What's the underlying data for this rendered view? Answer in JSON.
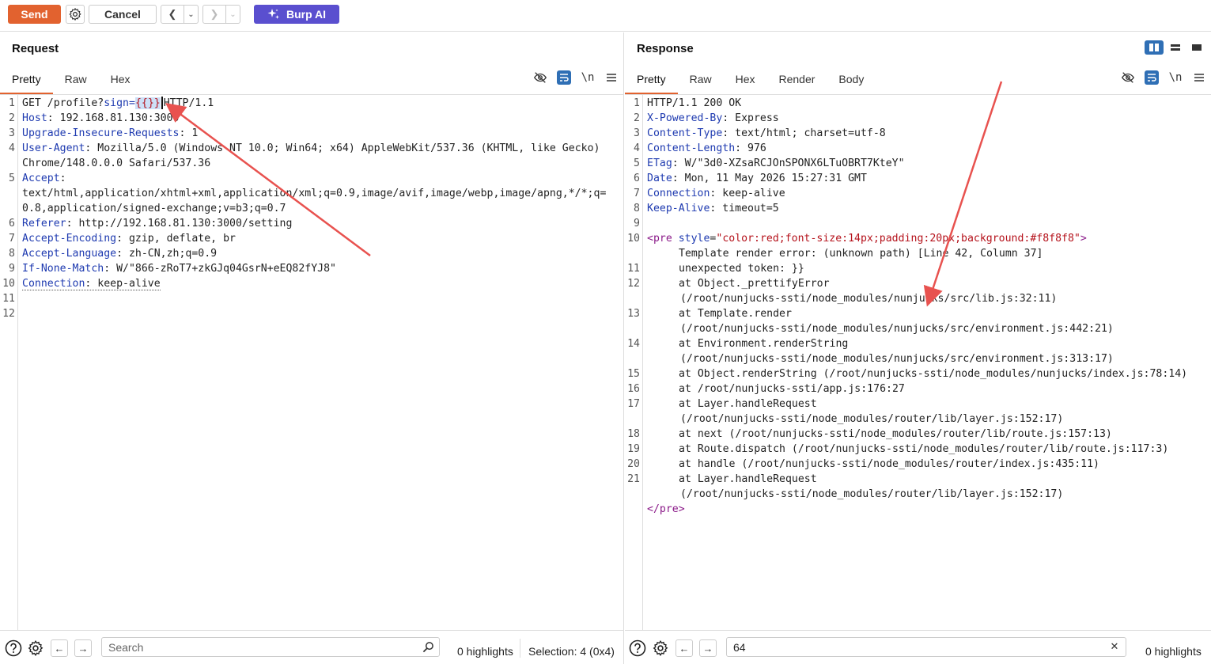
{
  "toolbar": {
    "send_label": "Send",
    "cancel_label": "Cancel",
    "burp_ai_label": "Burp AI"
  },
  "request": {
    "title": "Request",
    "tabs": [
      "Pretty",
      "Raw",
      "Hex"
    ],
    "active_tab": "Pretty",
    "wrap_icon": "\\n",
    "lines": [
      {
        "n": "1"
      },
      {
        "n": "2"
      },
      {
        "n": "3"
      },
      {
        "n": "4"
      },
      {
        "n": "5"
      },
      {
        "n": "6"
      },
      {
        "n": "7"
      },
      {
        "n": "8"
      },
      {
        "n": "9"
      },
      {
        "n": "10"
      },
      {
        "n": "11"
      },
      {
        "n": "12"
      }
    ],
    "text": {
      "l1a": "GET /profile?",
      "l1b": "sign",
      "l1c": "=",
      "l1d": "{{}}",
      "l1e": "HTTP/1.1",
      "l2k": "Host",
      "l2v": ": 192.168.81.130:3000",
      "l3k": "Upgrade-Insecure-Requests",
      "l3v": ": 1",
      "l4k": "User-Agent",
      "l4v": ": Mozilla/5.0 (Windows NT 10.0; Win64; x64) AppleWebKit/537.36 (KHTML, like Gecko)",
      "l4c": "Chrome/148.0.0.0 Safari/537.36",
      "l5k": "Accept",
      "l5v": ":",
      "l5c": "text/html,application/xhtml+xml,application/xml;q=0.9,image/avif,image/webp,image/apng,*/*;q=",
      "l5d": "0.8,application/signed-exchange;v=b3;q=0.7",
      "l6k": "Referer",
      "l6v": ": http://192.168.81.130:3000/setting",
      "l7k": "Accept-Encoding",
      "l7v": ": gzip, deflate, br",
      "l8k": "Accept-Language",
      "l8v": ": zh-CN,zh;q=0.9",
      "l9k": "If-None-Match",
      "l9v": ": W/\"866-zRoT7+zkGJq04GsrN+eEQ82fYJ8\"",
      "l10k": "Connection",
      "l10v": ": keep-alive"
    },
    "footer": {
      "search_placeholder": "Search",
      "highlights": "0 highlights",
      "selection": "Selection: 4 (0x4)"
    }
  },
  "response": {
    "title": "Response",
    "tabs": [
      "Pretty",
      "Raw",
      "Hex",
      "Render",
      "Body"
    ],
    "active_tab": "Pretty",
    "wrap_icon": "\\n",
    "text": {
      "l1": "HTTP/1.1 200 OK",
      "l2k": "X-Powered-By",
      "l2v": ": Express",
      "l3k": "Content-Type",
      "l3v": ": text/html; charset=utf-8",
      "l4k": "Content-Length",
      "l4v": ": 976",
      "l5k": "ETag",
      "l5v": ": W/\"3d0-XZsaRCJOnSPONX6LTuOBRT7KteY\"",
      "l6k": "Date",
      "l6v": ": Mon, 11 May 2026 15:27:31 GMT",
      "l7k": "Connection",
      "l7v": ": keep-alive",
      "l8k": "Keep-Alive",
      "l8v": ": timeout=5",
      "l10tag": "<pre",
      "l10attr": "style",
      "l10eq": "=",
      "l10str": "\"color:red;font-size:14px;padding:20px;background:#f8f8f8\"",
      "l10close": ">",
      "l10b": "Template render error: (unknown path) [Line 42, Column 37]",
      "l11": "unexpected token: }}",
      "l12a": "at Object._prettifyError",
      "l12b": "(/root/nunjucks-ssti/node_modules/nunjucks/src/lib.js:32:11)",
      "l13a": "at Template.render",
      "l13b": "(/root/nunjucks-ssti/node_modules/nunjucks/src/environment.js:442:21)",
      "l14a": "at Environment.renderString",
      "l14b": "(/root/nunjucks-ssti/node_modules/nunjucks/src/environment.js:313:17)",
      "l15": "at Object.renderString (/root/nunjucks-ssti/node_modules/nunjucks/index.js:78:14)",
      "l16": "at /root/nunjucks-ssti/app.js:176:27",
      "l17a": "at Layer.handleRequest",
      "l17b": "(/root/nunjucks-ssti/node_modules/router/lib/layer.js:152:17)",
      "l18": "at next (/root/nunjucks-ssti/node_modules/router/lib/route.js:157:13)",
      "l19": "at Route.dispatch (/root/nunjucks-ssti/node_modules/router/lib/route.js:117:3)",
      "l20": "at handle (/root/nunjucks-ssti/node_modules/router/index.js:435:11)",
      "l21a": "at Layer.handleRequest",
      "l21b": "(/root/nunjucks-ssti/node_modules/router/lib/layer.js:152:17)",
      "l22": "</pre>"
    },
    "line_numbers": [
      "1",
      "2",
      "3",
      "4",
      "5",
      "6",
      "7",
      "8",
      "9",
      "10",
      "11",
      "12",
      "13",
      "14",
      "15",
      "16",
      "17",
      "18",
      "19",
      "20",
      "21"
    ],
    "footer": {
      "search_value": "64",
      "highlights": "0 highlights"
    }
  },
  "colors": {
    "send": "#e2622f",
    "burp_ai": "#5a4fcf",
    "header_key": "#1e3ab0",
    "annotation_arrow": "#e8524f"
  }
}
